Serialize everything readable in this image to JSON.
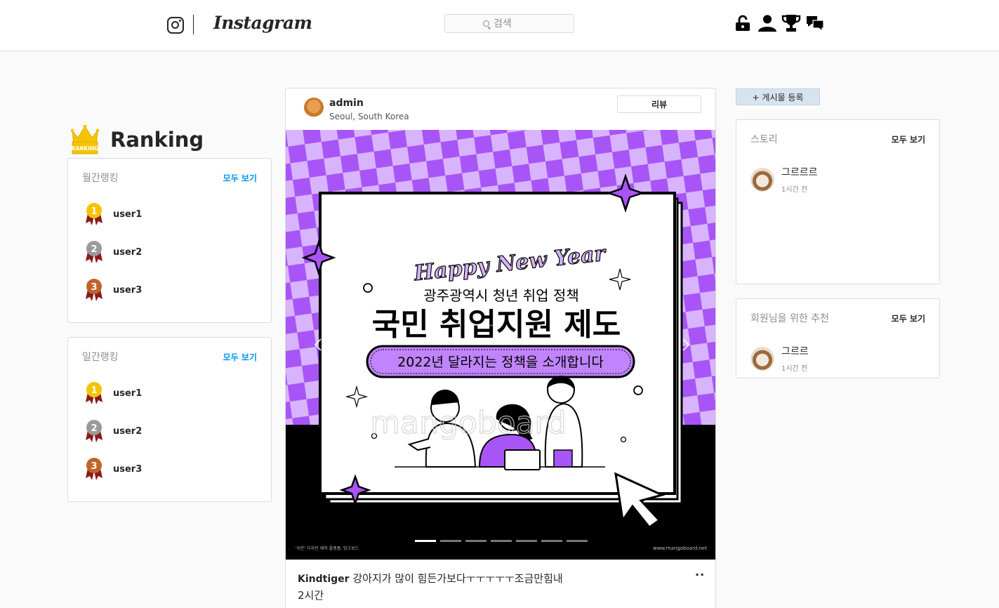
{
  "header": {
    "brand": "Instagram",
    "search_placeholder": "검색",
    "icons": [
      "unlock-icon",
      "user-icon",
      "trophy-icon",
      "messages-icon"
    ]
  },
  "ranking": {
    "title": "Ranking",
    "crown_label": "RANKING",
    "monthly": {
      "title": "월간랭킹",
      "more": "모두 보기",
      "items": [
        {
          "rank": "1",
          "user": "user1"
        },
        {
          "rank": "2",
          "user": "user2"
        },
        {
          "rank": "3",
          "user": "user3"
        }
      ]
    },
    "daily": {
      "title": "일간랭킹",
      "more": "모두 보기",
      "items": [
        {
          "rank": "1",
          "user": "user1"
        },
        {
          "rank": "2",
          "user": "user2"
        },
        {
          "rank": "3",
          "user": "user3"
        }
      ]
    }
  },
  "post": {
    "user": "admin",
    "location": "Seoul, South Korea",
    "review_label": "리뷰",
    "caption_user": "Kindtiger",
    "caption_text": "강아지가 많이 힘든가보다ㅜㅜㅜㅜㅜ조금만힘내",
    "time": "2시간",
    "more": "··",
    "image": {
      "script_title": "Happy New Year",
      "subtitle": "광주광역시 청년 취업 정책",
      "headline": "국민 취업지원 제도",
      "pill": "2022년 달라지는 정책을 소개합니다",
      "watermark": "mangoboard",
      "footer_left": "'위온' 디자인 제작 플랫폼, 망고보드",
      "footer_right": "www.mangoboard.net",
      "carousel_total": 7,
      "carousel_active": 1
    }
  },
  "sidebar": {
    "new_post": "+ 게시물 등록",
    "story": {
      "title": "스토리",
      "more": "모두 보기",
      "items": [
        {
          "name": "그르르르",
          "time": "1시간 전"
        }
      ]
    },
    "recommend": {
      "title": "회원님을 위한 추천",
      "more": "모두 보기",
      "items": [
        {
          "name": "그르르",
          "time": "1시간 전"
        }
      ]
    }
  },
  "colors": {
    "purple": "#a855f7",
    "light_purple": "#d8b4fe",
    "link": "#0095f6",
    "gold": "#f5c400",
    "silver": "#9a9a9a",
    "bronze": "#c0642b",
    "ribbon": "#8b1a1a"
  }
}
